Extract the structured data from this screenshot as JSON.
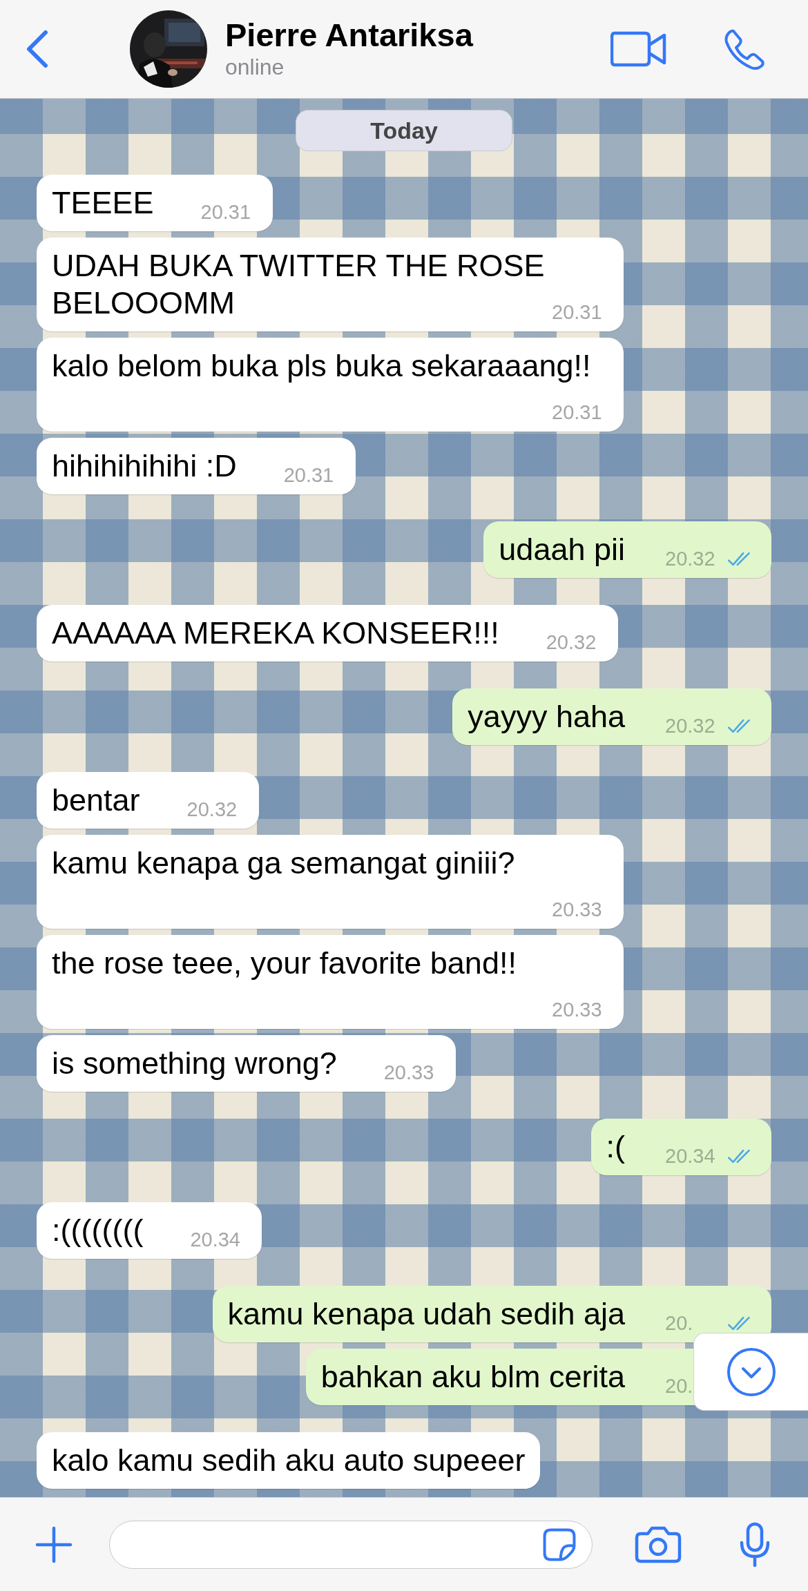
{
  "contact": {
    "name": "Pierre Antariksa",
    "status": "online"
  },
  "date_label": "Today",
  "messages": [
    {
      "kind": "incoming",
      "text": "TEEEE",
      "time": "20.31"
    },
    {
      "kind": "incoming",
      "text": "UDAH BUKA TWITTER THE ROSE BELOOOMM",
      "time": "20.31"
    },
    {
      "kind": "incoming",
      "text": "kalo belom buka pls buka sekaraaang!!",
      "time": "20.31"
    },
    {
      "kind": "incoming",
      "text": "hihihihihihi :D",
      "time": "20.31"
    },
    {
      "kind": "outgoing",
      "text": "udaah pii",
      "time": "20.32",
      "read": true
    },
    {
      "kind": "incoming",
      "text": "AAAAAA MEREKA KONSEER!!!",
      "time": "20.32"
    },
    {
      "kind": "outgoing",
      "text": "yayyy haha",
      "time": "20.32",
      "read": true
    },
    {
      "kind": "incoming",
      "text": "bentar",
      "time": "20.32"
    },
    {
      "kind": "incoming",
      "text": "kamu kenapa ga semangat giniii?",
      "time": "20.33"
    },
    {
      "kind": "incoming",
      "text": "the rose teee, your favorite band!!",
      "time": "20.33"
    },
    {
      "kind": "incoming",
      "text": "is something wrong?",
      "time": "20.33"
    },
    {
      "kind": "outgoing",
      "text": ":(",
      "time": "20.34",
      "read": true
    },
    {
      "kind": "incoming",
      "text": ":((((((((",
      "time": "20.34"
    },
    {
      "kind": "outgoing",
      "text": "kamu kenapa udah sedih aja",
      "time": "20.",
      "read": true
    },
    {
      "kind": "outgoing",
      "text": "bahkan aku blm cerita",
      "time": "20."
    },
    {
      "kind": "incoming",
      "text": "kalo kamu sedih aku auto supeeer"
    }
  ]
}
